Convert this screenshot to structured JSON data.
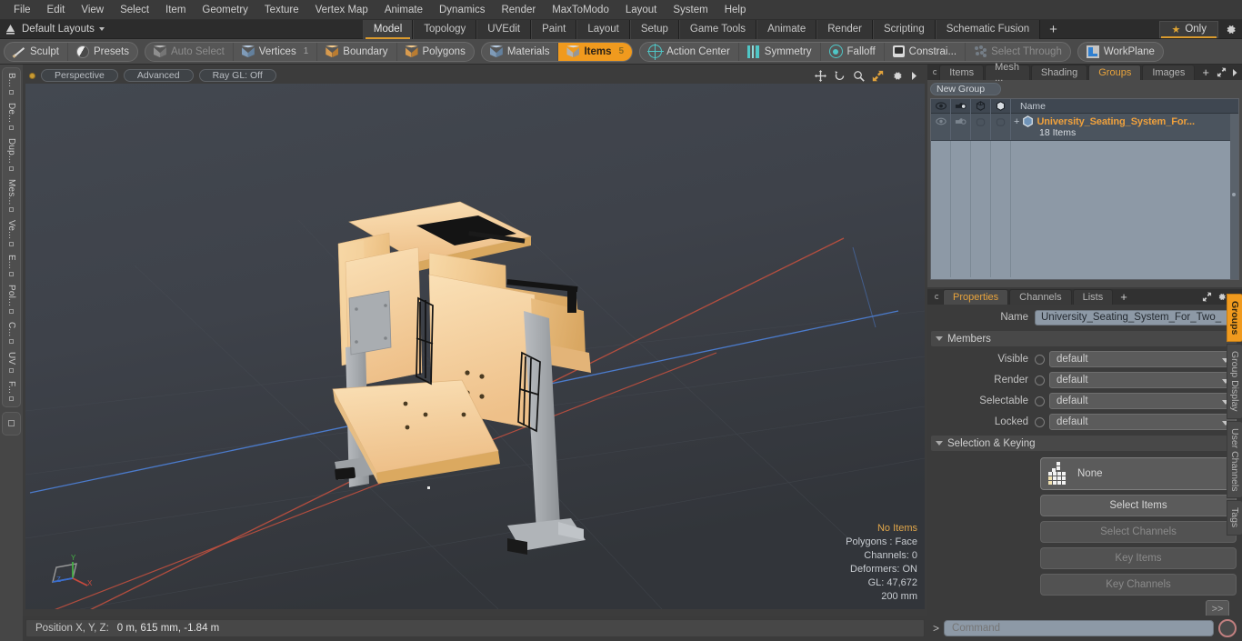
{
  "menubar": {
    "items": [
      "File",
      "Edit",
      "View",
      "Select",
      "Item",
      "Geometry",
      "Texture",
      "Vertex Map",
      "Animate",
      "Dynamics",
      "Render",
      "MaxToModo",
      "Layout",
      "System",
      "Help"
    ]
  },
  "layoutbar": {
    "layout_name": "Default Layouts",
    "tabs": [
      "Model",
      "Topology",
      "UVEdit",
      "Paint",
      "Layout",
      "Setup",
      "Game Tools",
      "Animate",
      "Render",
      "Scripting",
      "Schematic Fusion"
    ],
    "active_tab": "Model",
    "add_tab": "+",
    "only_label": "Only"
  },
  "modebar": {
    "group1": [
      {
        "label": "Sculpt",
        "icon": "pencil-icon",
        "state": "normal",
        "count": ""
      },
      {
        "label": "Presets",
        "icon": "sphere-icon",
        "state": "normal",
        "count": ""
      }
    ],
    "group2": [
      {
        "label": "Auto Select",
        "icon": "cube-gray-icon",
        "state": "dim",
        "count": ""
      },
      {
        "label": "Vertices",
        "icon": "cube-blue-icon",
        "state": "normal",
        "count": "1"
      },
      {
        "label": "Boundary",
        "icon": "cube-orange-icon",
        "state": "normal",
        "count": ""
      },
      {
        "label": "Polygons",
        "icon": "cube-orange-icon",
        "state": "normal",
        "count": ""
      }
    ],
    "group3": [
      {
        "label": "Materials",
        "icon": "cube-blue-icon",
        "state": "normal",
        "count": ""
      },
      {
        "label": "Items",
        "icon": "cube-white-icon",
        "state": "selected",
        "count": "5"
      }
    ],
    "group4": [
      {
        "label": "Action Center",
        "icon": "target-icon",
        "state": "normal",
        "count": ""
      },
      {
        "label": "Symmetry",
        "icon": "symmetry-icon",
        "state": "normal",
        "count": ""
      },
      {
        "label": "Falloff",
        "icon": "falloff-icon",
        "state": "normal",
        "count": ""
      },
      {
        "label": "Constrai...",
        "icon": "constraint-icon",
        "state": "normal",
        "count": ""
      },
      {
        "label": "Select Through",
        "icon": "select-through-icon",
        "state": "dim",
        "count": ""
      }
    ],
    "group5": [
      {
        "label": "WorkPlane",
        "icon": "workplane-icon",
        "state": "normal",
        "count": ""
      }
    ]
  },
  "leftrail": {
    "tabs": [
      "B...",
      "De...",
      "Dup...",
      "Mes...",
      "Ve...",
      "E...",
      "Pol...",
      "C...",
      "UV",
      "F..."
    ]
  },
  "viewport": {
    "header": {
      "view_mode": "Perspective",
      "shading": "Advanced",
      "raygl": "Ray GL: Off",
      "icons": [
        "move-icon",
        "rotate-icon",
        "zoom-icon",
        "fit-icon",
        "gear-icon",
        "chevron-right-icon"
      ]
    },
    "stats": {
      "selection": "No Items",
      "polygons": "Polygons : Face",
      "channels": "Channels: 0",
      "deformers": "Deformers: ON",
      "gl": "GL: 47,672",
      "grid": "200 mm"
    },
    "axes": {
      "x": "X",
      "y": "Y",
      "z": "Z"
    }
  },
  "groups_panel": {
    "tabs": [
      "Items",
      "Mesh ...",
      "Shading",
      "Groups",
      "Images"
    ],
    "active_tab": "Groups",
    "add_tab": "+",
    "new_group_button": "New Group",
    "columns": [
      "eye-icon",
      "render-icon",
      "select-icon",
      "lock-icon",
      "Name"
    ],
    "rows": [
      {
        "name": "University_Seating_System_For...",
        "subtitle": "18 Items",
        "expander": "+"
      }
    ]
  },
  "properties_panel": {
    "tabs": [
      "Properties",
      "Channels",
      "Lists"
    ],
    "active_tab": "Properties",
    "add_tab": "+",
    "name_label": "Name",
    "name_value": "University_Seating_System_For_Two_",
    "members_section": "Members",
    "members": [
      {
        "label": "Visible",
        "value": "default"
      },
      {
        "label": "Render",
        "value": "default"
      },
      {
        "label": "Selectable",
        "value": "default"
      },
      {
        "label": "Locked",
        "value": "default"
      }
    ],
    "selection_section": "Selection & Keying",
    "selection_set": "None",
    "buttons": [
      {
        "label": "Select Items",
        "enabled": true
      },
      {
        "label": "Select Channels",
        "enabled": false
      },
      {
        "label": "Key Items",
        "enabled": false
      },
      {
        "label": "Key Channels",
        "enabled": false
      }
    ],
    "expand_button": ">>"
  },
  "vtabs": {
    "items": [
      "Groups",
      "Group Display",
      "User Channels",
      "Tags"
    ],
    "active": "Groups"
  },
  "statusbar": {
    "position_label": "Position X, Y, Z:",
    "position_value": "0 m, 615 mm, -1.84 m"
  },
  "commandbar": {
    "prompt": ">",
    "placeholder": "Command",
    "record_icon": "record-icon"
  },
  "colors": {
    "accent_orange": "#f09a1e",
    "tab_underline": "#d99a2e",
    "panel_bg": "#3b3b3b",
    "field_bg": "#8d99a6",
    "axis_x": "#c14a4a",
    "axis_y": "#4aa84a",
    "axis_z": "#3a6ec4"
  }
}
